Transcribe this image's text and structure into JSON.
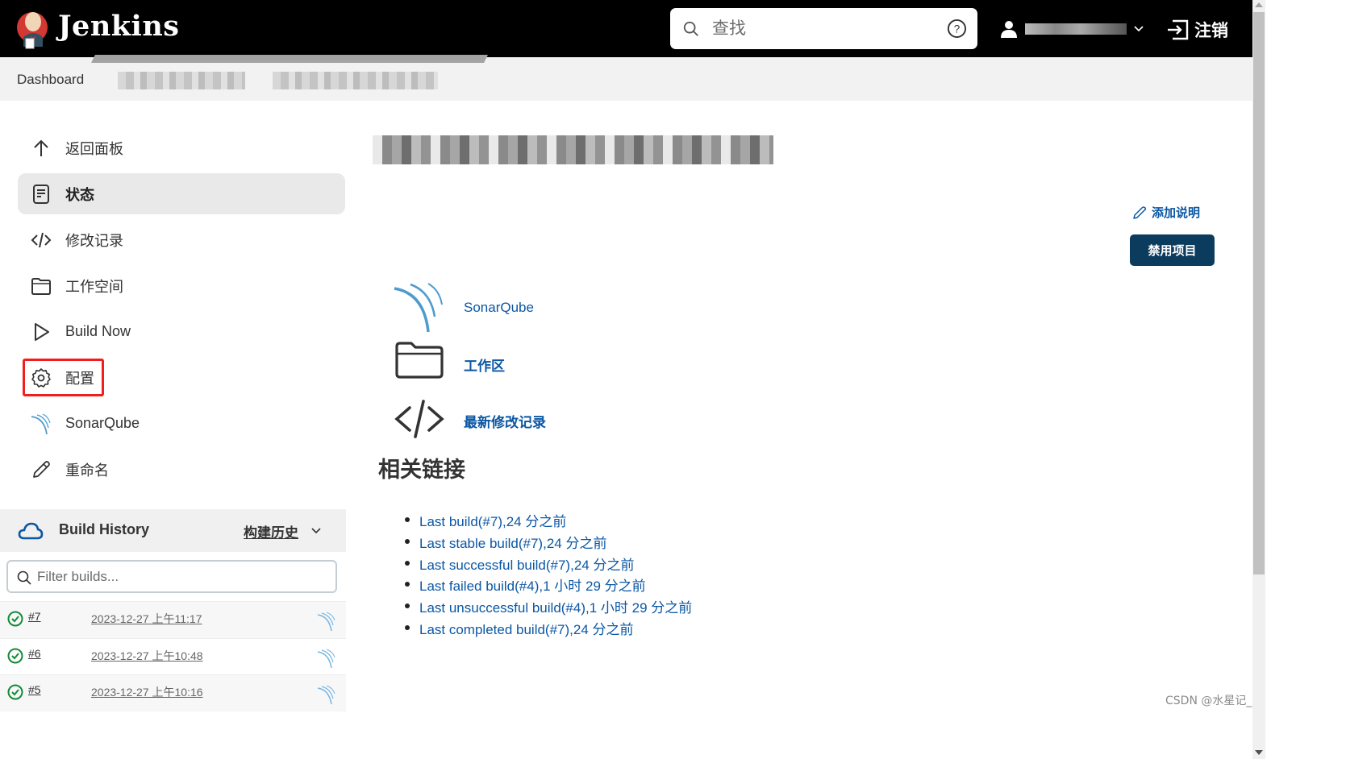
{
  "header": {
    "brand": "Jenkins",
    "search": {
      "placeholder": "查找",
      "value": ""
    },
    "user_name": "[redacted]",
    "logout_label": "注销"
  },
  "breadcrumb": {
    "items": [
      {
        "label": "Dashboard"
      },
      {
        "label": "[redacted]"
      },
      {
        "label": "[redacted]"
      }
    ]
  },
  "sidebar": {
    "items": [
      {
        "label": "返回面板",
        "icon": "arrow-up-icon",
        "active": false
      },
      {
        "label": "状态",
        "icon": "document-icon",
        "active": true
      },
      {
        "label": "修改记录",
        "icon": "code-icon",
        "active": false
      },
      {
        "label": "工作空间",
        "icon": "folder-icon",
        "active": false
      },
      {
        "label": "Build Now",
        "icon": "play-icon",
        "active": false
      },
      {
        "label": "配置",
        "icon": "gear-icon",
        "active": false,
        "highlighted": true
      },
      {
        "label": "SonarQube",
        "icon": "sonarqube-icon",
        "active": false
      },
      {
        "label": "重命名",
        "icon": "pencil-icon",
        "active": false
      }
    ]
  },
  "build_history": {
    "title": "Build History",
    "trend_label": "构建历史",
    "filter_placeholder": "Filter builds...",
    "builds": [
      {
        "number": "#7",
        "time": "2023-12-27 上午11:17",
        "status": "success"
      },
      {
        "number": "#6",
        "time": "2023-12-27 上午10:48",
        "status": "success"
      },
      {
        "number": "#5",
        "time": "2023-12-27 上午10:16",
        "status": "success"
      }
    ]
  },
  "main": {
    "project_title": "[redacted]",
    "add_description_label": "添加说明",
    "disable_button_label": "禁用项目",
    "links": [
      {
        "label": "SonarQube",
        "icon": "sonarqube-icon"
      },
      {
        "label": "工作区",
        "icon": "folder-icon"
      },
      {
        "label": "最新修改记录",
        "icon": "code-icon"
      }
    ],
    "related_heading": "相关链接",
    "related_links": [
      "Last build(#7),24 分之前",
      "Last stable build(#7),24 分之前",
      "Last successful build(#7),24 分之前",
      "Last failed build(#4),1 小时 29 分之前",
      "Last unsuccessful build(#4),1 小时 29 分之前",
      "Last completed build(#7),24 分之前"
    ]
  },
  "colors": {
    "header_bg": "#000000",
    "link": "#0b57a4",
    "primary_button": "#0b3b5d",
    "success": "#138a36",
    "highlight": "#f01e1e",
    "sonarqube": "#4e9bcd"
  },
  "watermark": "CSDN @水星记_"
}
